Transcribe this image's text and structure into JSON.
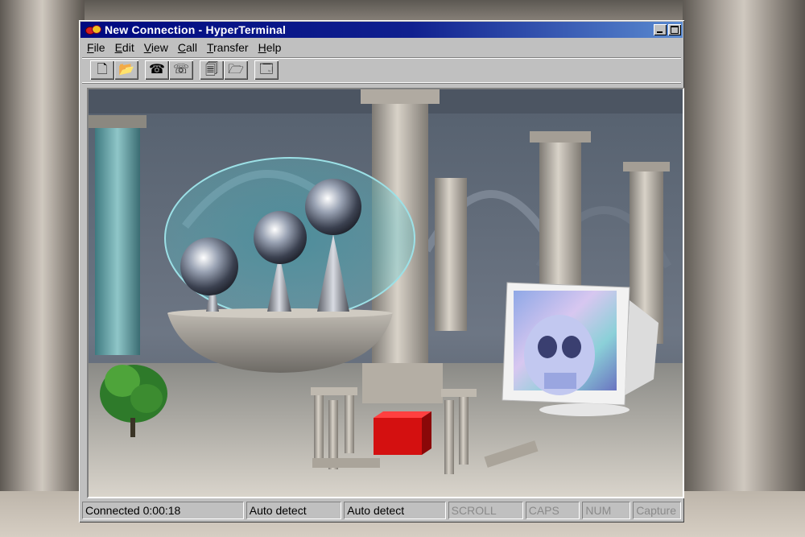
{
  "window": {
    "title": "New Connection - HyperTerminal",
    "app_icon": "hyperterminal-icon"
  },
  "menu": [
    {
      "key": "file",
      "label": "File",
      "accel": "F",
      "rest": "ile"
    },
    {
      "key": "edit",
      "label": "Edit",
      "accel": "E",
      "rest": "dit"
    },
    {
      "key": "view",
      "label": "View",
      "accel": "V",
      "rest": "iew"
    },
    {
      "key": "call",
      "label": "Call",
      "accel": "C",
      "rest": "all"
    },
    {
      "key": "transfer",
      "label": "Transfer",
      "accel": "T",
      "rest": "ransfer"
    },
    {
      "key": "help",
      "label": "Help",
      "accel": "H",
      "rest": "elp"
    }
  ],
  "toolbar": {
    "groups": [
      [
        {
          "name": "new-icon",
          "glyph": "🗋"
        },
        {
          "name": "open-icon",
          "glyph": "📂"
        }
      ],
      [
        {
          "name": "connect-icon",
          "glyph": "☎"
        },
        {
          "name": "disconnect-icon",
          "glyph": "☏"
        }
      ],
      [
        {
          "name": "send-icon",
          "glyph": "🗐"
        },
        {
          "name": "receive-icon",
          "glyph": "🗁"
        }
      ],
      [
        {
          "name": "properties-icon",
          "glyph": "🗔"
        }
      ]
    ]
  },
  "status": {
    "connected": "Connected 0:00:18",
    "detect1": "Auto detect",
    "detect2": "Auto detect",
    "scroll": "SCROLL",
    "caps": "CAPS",
    "num": "NUM",
    "capture": "Capture"
  }
}
